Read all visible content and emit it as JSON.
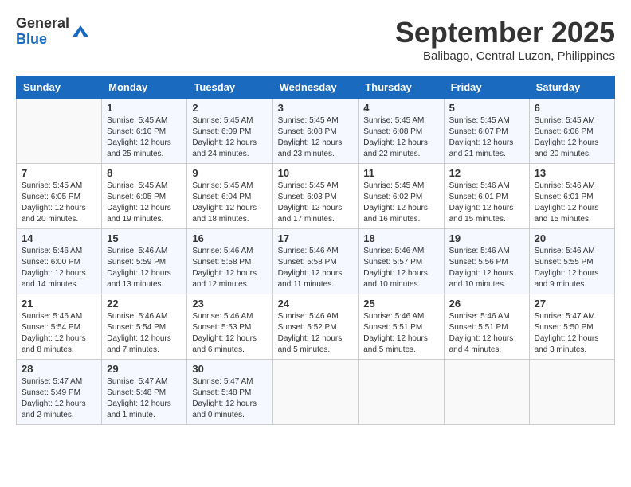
{
  "header": {
    "logo_general": "General",
    "logo_blue": "Blue",
    "month_title": "September 2025",
    "subtitle": "Balibago, Central Luzon, Philippines"
  },
  "weekdays": [
    "Sunday",
    "Monday",
    "Tuesday",
    "Wednesday",
    "Thursday",
    "Friday",
    "Saturday"
  ],
  "weeks": [
    [
      {
        "day": "",
        "info": ""
      },
      {
        "day": "1",
        "info": "Sunrise: 5:45 AM\nSunset: 6:10 PM\nDaylight: 12 hours\nand 25 minutes."
      },
      {
        "day": "2",
        "info": "Sunrise: 5:45 AM\nSunset: 6:09 PM\nDaylight: 12 hours\nand 24 minutes."
      },
      {
        "day": "3",
        "info": "Sunrise: 5:45 AM\nSunset: 6:08 PM\nDaylight: 12 hours\nand 23 minutes."
      },
      {
        "day": "4",
        "info": "Sunrise: 5:45 AM\nSunset: 6:08 PM\nDaylight: 12 hours\nand 22 minutes."
      },
      {
        "day": "5",
        "info": "Sunrise: 5:45 AM\nSunset: 6:07 PM\nDaylight: 12 hours\nand 21 minutes."
      },
      {
        "day": "6",
        "info": "Sunrise: 5:45 AM\nSunset: 6:06 PM\nDaylight: 12 hours\nand 20 minutes."
      }
    ],
    [
      {
        "day": "7",
        "info": "Sunrise: 5:45 AM\nSunset: 6:05 PM\nDaylight: 12 hours\nand 20 minutes."
      },
      {
        "day": "8",
        "info": "Sunrise: 5:45 AM\nSunset: 6:05 PM\nDaylight: 12 hours\nand 19 minutes."
      },
      {
        "day": "9",
        "info": "Sunrise: 5:45 AM\nSunset: 6:04 PM\nDaylight: 12 hours\nand 18 minutes."
      },
      {
        "day": "10",
        "info": "Sunrise: 5:45 AM\nSunset: 6:03 PM\nDaylight: 12 hours\nand 17 minutes."
      },
      {
        "day": "11",
        "info": "Sunrise: 5:45 AM\nSunset: 6:02 PM\nDaylight: 12 hours\nand 16 minutes."
      },
      {
        "day": "12",
        "info": "Sunrise: 5:46 AM\nSunset: 6:01 PM\nDaylight: 12 hours\nand 15 minutes."
      },
      {
        "day": "13",
        "info": "Sunrise: 5:46 AM\nSunset: 6:01 PM\nDaylight: 12 hours\nand 15 minutes."
      }
    ],
    [
      {
        "day": "14",
        "info": "Sunrise: 5:46 AM\nSunset: 6:00 PM\nDaylight: 12 hours\nand 14 minutes."
      },
      {
        "day": "15",
        "info": "Sunrise: 5:46 AM\nSunset: 5:59 PM\nDaylight: 12 hours\nand 13 minutes."
      },
      {
        "day": "16",
        "info": "Sunrise: 5:46 AM\nSunset: 5:58 PM\nDaylight: 12 hours\nand 12 minutes."
      },
      {
        "day": "17",
        "info": "Sunrise: 5:46 AM\nSunset: 5:58 PM\nDaylight: 12 hours\nand 11 minutes."
      },
      {
        "day": "18",
        "info": "Sunrise: 5:46 AM\nSunset: 5:57 PM\nDaylight: 12 hours\nand 10 minutes."
      },
      {
        "day": "19",
        "info": "Sunrise: 5:46 AM\nSunset: 5:56 PM\nDaylight: 12 hours\nand 10 minutes."
      },
      {
        "day": "20",
        "info": "Sunrise: 5:46 AM\nSunset: 5:55 PM\nDaylight: 12 hours\nand 9 minutes."
      }
    ],
    [
      {
        "day": "21",
        "info": "Sunrise: 5:46 AM\nSunset: 5:54 PM\nDaylight: 12 hours\nand 8 minutes."
      },
      {
        "day": "22",
        "info": "Sunrise: 5:46 AM\nSunset: 5:54 PM\nDaylight: 12 hours\nand 7 minutes."
      },
      {
        "day": "23",
        "info": "Sunrise: 5:46 AM\nSunset: 5:53 PM\nDaylight: 12 hours\nand 6 minutes."
      },
      {
        "day": "24",
        "info": "Sunrise: 5:46 AM\nSunset: 5:52 PM\nDaylight: 12 hours\nand 5 minutes."
      },
      {
        "day": "25",
        "info": "Sunrise: 5:46 AM\nSunset: 5:51 PM\nDaylight: 12 hours\nand 5 minutes."
      },
      {
        "day": "26",
        "info": "Sunrise: 5:46 AM\nSunset: 5:51 PM\nDaylight: 12 hours\nand 4 minutes."
      },
      {
        "day": "27",
        "info": "Sunrise: 5:47 AM\nSunset: 5:50 PM\nDaylight: 12 hours\nand 3 minutes."
      }
    ],
    [
      {
        "day": "28",
        "info": "Sunrise: 5:47 AM\nSunset: 5:49 PM\nDaylight: 12 hours\nand 2 minutes."
      },
      {
        "day": "29",
        "info": "Sunrise: 5:47 AM\nSunset: 5:48 PM\nDaylight: 12 hours\nand 1 minute."
      },
      {
        "day": "30",
        "info": "Sunrise: 5:47 AM\nSunset: 5:48 PM\nDaylight: 12 hours\nand 0 minutes."
      },
      {
        "day": "",
        "info": ""
      },
      {
        "day": "",
        "info": ""
      },
      {
        "day": "",
        "info": ""
      },
      {
        "day": "",
        "info": ""
      }
    ]
  ]
}
